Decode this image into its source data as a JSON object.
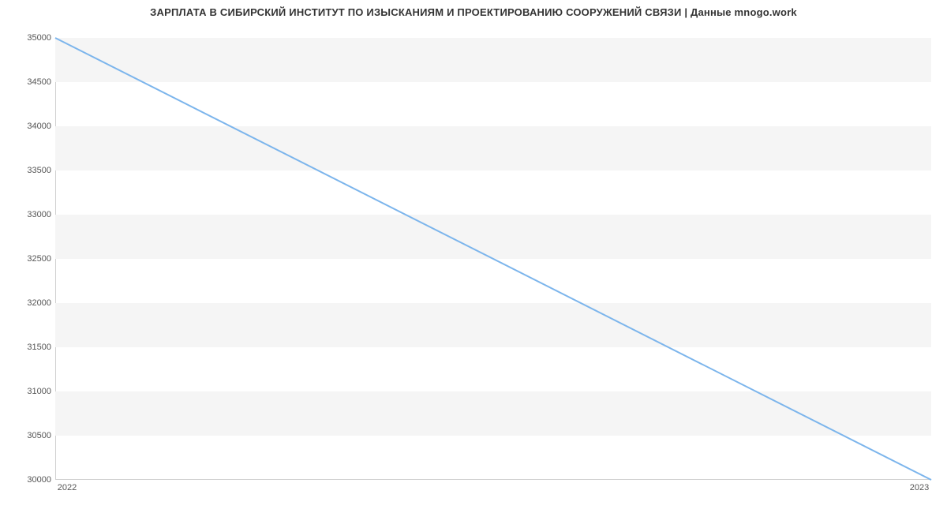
{
  "chart_data": {
    "type": "line",
    "title": "ЗАРПЛАТА В  СИБИРСКИЙ ИНСТИТУТ ПО ИЗЫСКАНИЯМ И ПРОЕКТИРОВАНИЮ СООРУЖЕНИЙ СВЯЗИ | Данные mnogo.work",
    "x": [
      "2022",
      "2023"
    ],
    "values": [
      35000,
      30000
    ],
    "xlabel": "",
    "ylabel": "",
    "ylim": [
      30000,
      35000
    ],
    "y_ticks": [
      30000,
      30500,
      31000,
      31500,
      32000,
      32500,
      33000,
      33500,
      34000,
      34500,
      35000
    ],
    "x_ticks": [
      "2022",
      "2023"
    ],
    "line_color": "#7cb5ec",
    "band_color": "#f5f5f5"
  }
}
